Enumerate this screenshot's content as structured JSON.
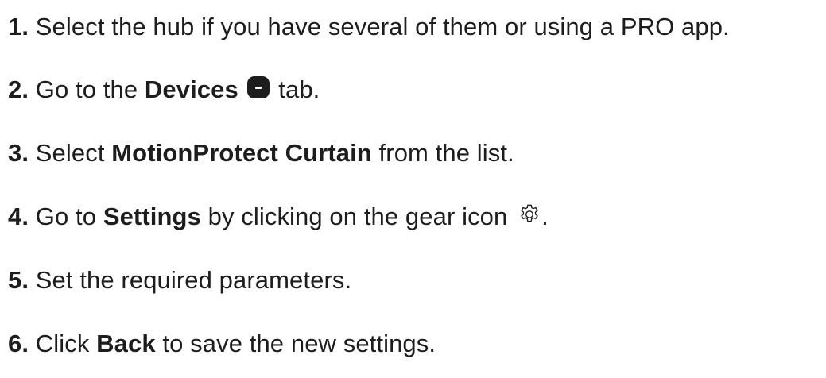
{
  "steps": [
    {
      "number": "1.",
      "text": " Select the hub if you have several of them or using a PRO app."
    },
    {
      "number": "2.",
      "pre": " Go to the ",
      "bold": "Devices",
      "icon": "devices-tab-icon",
      "post": " tab."
    },
    {
      "number": "3.",
      "pre": " Select ",
      "bold": "MotionProtect Curtain",
      "post": " from the list."
    },
    {
      "number": "4.",
      "pre": " Go to ",
      "bold": "Settings",
      "mid": " by clicking on the gear icon ",
      "icon": "gear-icon",
      "post": "."
    },
    {
      "number": "5.",
      "text": " Set the required parameters."
    },
    {
      "number": "6.",
      "pre": " Click ",
      "bold": "Back",
      "post": " to save the new settings."
    }
  ]
}
